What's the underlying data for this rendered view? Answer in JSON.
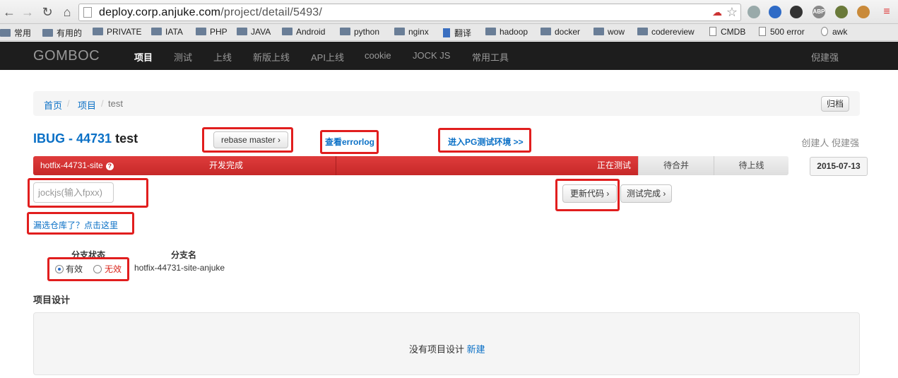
{
  "browser": {
    "url_host": "deploy.corp.anjuke.com",
    "url_path": "/project/detail/5493/",
    "bookmarks": [
      "常用",
      "有用的",
      "PRIVATE",
      "IATA",
      "PHP",
      "JAVA",
      "Android",
      "python",
      "nginx",
      "翻译",
      "hadoop",
      "docker",
      "wow",
      "codereview",
      "CMDB",
      "500 error",
      "awk"
    ],
    "ext_abp": "ABP"
  },
  "navbar": {
    "brand": "GOMBOC",
    "items": [
      "项目",
      "测试",
      "上线",
      "新版上线",
      "API上线",
      "cookie",
      "JOCK JS",
      "常用工具"
    ],
    "user": "倪建强"
  },
  "breadcrumb": {
    "home": "首页",
    "projects": "项目",
    "current": "test",
    "sep": "/",
    "archive_button": "归档"
  },
  "project": {
    "code": "IBUG - 44731",
    "name": "test",
    "rebase_button": "rebase master ›",
    "errorlog_link": "查看errorlog",
    "pg_link": "进入PG测试环境 >>",
    "creator": "创建人 倪建强",
    "date": "2015-07-13"
  },
  "progress": {
    "branch": "hotfix-44731-site",
    "help_icon": "?",
    "stage_done": "开发完成",
    "stage_current": "正在测试",
    "stage_merge": "待合并",
    "stage_release": "待上线"
  },
  "actions": {
    "jock_placeholder": "jockjs(输入fpxx)",
    "update_code_button": "更新代码 ›",
    "test_done_button": "测试完成 ›",
    "missing_repo_link": "漏选仓库了？点击这里"
  },
  "branches": {
    "col_status": "分支状态",
    "col_name": "分支名",
    "valid_label": "有效",
    "invalid_label": "无效",
    "branch_name": "hotfix-44731-site-anjuke"
  },
  "design": {
    "title": "项目设计",
    "empty_text": "没有项目设计",
    "new_link": "新建"
  }
}
